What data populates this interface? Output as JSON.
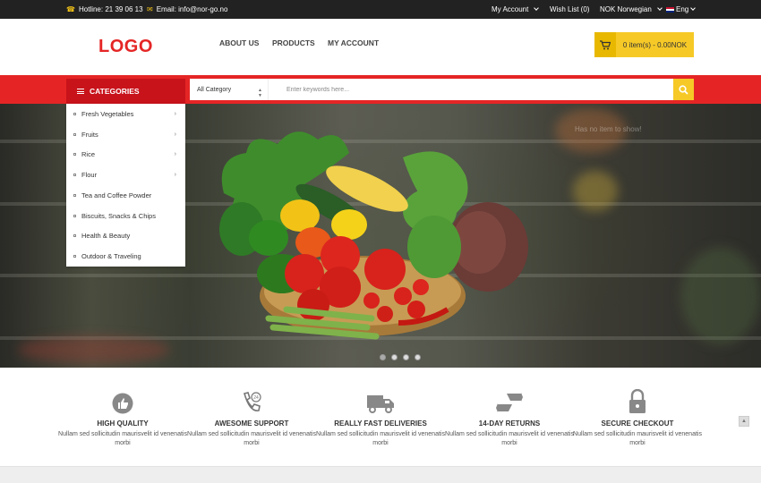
{
  "topbar": {
    "hotline": "Hotline: 21 39 06 13",
    "email": "Email: info@nor-go.no",
    "my_account": "My Account",
    "wish_list": "Wish List (0)",
    "currency": "NOK Norwegian",
    "language": "Eng"
  },
  "header": {
    "logo": "LOGO",
    "nav": [
      "ABOUT US",
      "PRODUCTS",
      "MY ACCOUNT"
    ],
    "cart_text": "0 item(s) - 0.00NOK"
  },
  "searchbar": {
    "categories_label": "CATEGORIES",
    "category_select": "All Category",
    "placeholder": "Enter keywords here..."
  },
  "categories": [
    {
      "label": "Fresh Vegetables",
      "has_sub": true
    },
    {
      "label": "Fruits",
      "has_sub": true
    },
    {
      "label": "Rice",
      "has_sub": true
    },
    {
      "label": "Flour",
      "has_sub": true
    },
    {
      "label": "Tea and Coffee Powder",
      "has_sub": false
    },
    {
      "label": "Biscuits, Snacks & Chips",
      "has_sub": false
    },
    {
      "label": "Health & Beauty",
      "has_sub": false
    },
    {
      "label": "Outdoor & Traveling",
      "has_sub": false
    }
  ],
  "hero": {
    "empty_message": "Has no item to show!",
    "slide_count": 4,
    "active_slide": 1
  },
  "features": [
    {
      "icon": "thumbs-up-icon",
      "title": "HIGH QUALITY",
      "desc": "Nullam sed sollicitudin maurisvelit id venenatis morbi"
    },
    {
      "icon": "support-phone-icon",
      "title": "AWESOME SUPPORT",
      "desc": "Nullam sed sollicitudin maurisvelit id venenatis morbi"
    },
    {
      "icon": "delivery-truck-icon",
      "title": "REALLY FAST DELIVERIES",
      "desc": "Nullam sed sollicitudin maurisvelit id venenatis morbi"
    },
    {
      "icon": "return-arrows-icon",
      "title": "14-DAY RETURNS",
      "desc": "Nullam sed sollicitudin maurisvelit id venenatis morbi"
    },
    {
      "icon": "lock-icon",
      "title": "SECURE CHECKOUT",
      "desc": "Nullam sed sollicitudin maurisvelit id venenatis morbi"
    }
  ],
  "colors": {
    "accent_red": "#e52525",
    "dark_red": "#c8131b",
    "accent_yellow": "#f6c927",
    "topbar_bg": "#222222"
  }
}
